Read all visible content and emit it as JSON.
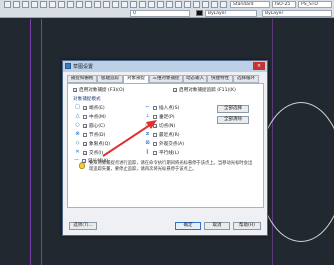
{
  "toolbar": {
    "workspace": "Standard",
    "std_label": "ISO-25",
    "std2": "PS_STD",
    "layer_value": "0",
    "color_label": "ByLayer",
    "linetype_label": "ByLayer"
  },
  "dialog": {
    "title": "草图设置",
    "close_glyph": "×",
    "tabs": [
      "捕捉和栅格",
      "极轴追踪",
      "对象捕捉",
      "三维对象捕捉",
      "动态输入",
      "快捷特性",
      "选择循环"
    ],
    "snap_on": "启用对象捕捉 (F3)(O)",
    "track_on": "启用对象捕捉追踪 (F11)(K)",
    "modes_heading": "对象捕捉模式",
    "left_modes": [
      {
        "symbol": "□",
        "label": "端点(E)",
        "checked": true
      },
      {
        "symbol": "△",
        "label": "中点(M)",
        "checked": false
      },
      {
        "symbol": "○",
        "label": "圆心(C)",
        "checked": true
      },
      {
        "symbol": "⊗",
        "label": "节点(D)",
        "checked": false
      },
      {
        "symbol": "◇",
        "label": "象限点(Q)",
        "checked": true
      },
      {
        "symbol": "✕",
        "label": "交点(I)",
        "checked": true
      },
      {
        "symbol": "—",
        "label": "延长线(X)",
        "checked": true
      }
    ],
    "right_modes": [
      {
        "symbol": "⌐",
        "label": "插入点(S)",
        "checked": false
      },
      {
        "symbol": "⊥",
        "label": "垂足(P)",
        "checked": false
      },
      {
        "symbol": "◷",
        "label": "切点(N)",
        "checked": true
      },
      {
        "symbol": "⧖",
        "label": "最近点(R)",
        "checked": false
      },
      {
        "symbol": "⊠",
        "label": "外观交点(A)",
        "checked": false
      },
      {
        "symbol": "∥",
        "label": "平行线(L)",
        "checked": false
      }
    ],
    "select_all": "全部选择",
    "clear_all": "全部清除",
    "note": "要从对象捕捉点进行追踪，请在命令执行期间将光标悬停于该点上。当移动光标时会出现追踪矢量，要停止追踪，请再次将光标悬停于该点上。",
    "options_button": "选项(T)...",
    "ok_button": "确定",
    "cancel_button": "取消",
    "help_button": "帮助(H)",
    "colors": {
      "accent": "#2f74c9",
      "arrow": "#e03030",
      "guide_line": "#7b3fa8"
    }
  }
}
